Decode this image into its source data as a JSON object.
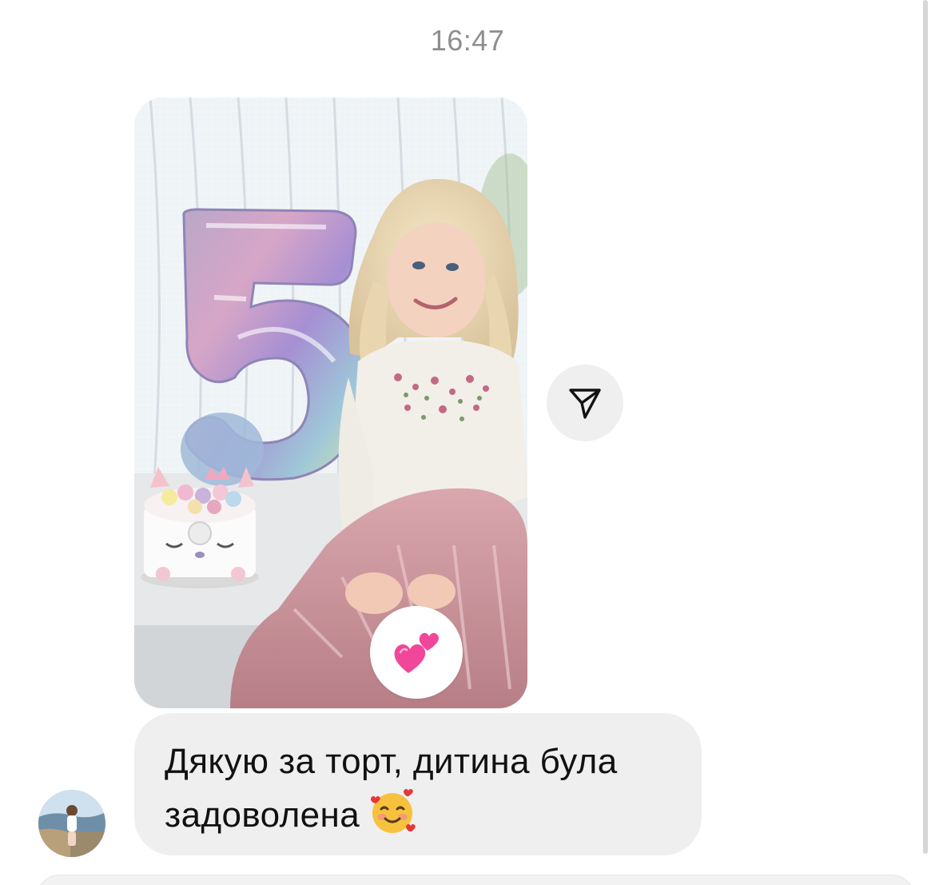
{
  "timestamp": "16:47",
  "photo_message": {
    "balloon_text": "5"
  },
  "reaction": {
    "emoji": "💕"
  },
  "text_message": {
    "line1": "Дякую за торт, дитина була",
    "line2": "задоволена",
    "emoji": "🥰"
  },
  "icons": {
    "share": "paper-plane-icon",
    "reaction": "two-hearts-icon",
    "inline_emoji": "smiling-face-with-hearts-icon"
  },
  "colors": {
    "bubble": "#efefef",
    "timestamp": "#8e8e8e",
    "text": "#111111",
    "heart": "#f0479a"
  }
}
